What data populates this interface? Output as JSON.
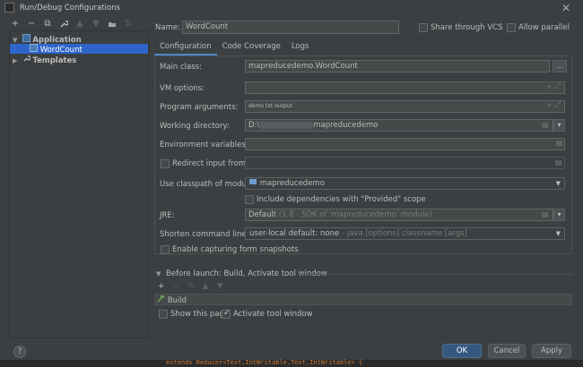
{
  "window": {
    "title": "Run/Debug Configurations",
    "close_glyph": "✕"
  },
  "toolbar": {
    "icons": [
      "add-icon",
      "remove-icon",
      "copy-icon",
      "wrench-icon",
      "move-up-icon",
      "move-down-icon",
      "folder-icon",
      "sort-icon"
    ],
    "glyphs": [
      "+",
      "−",
      "⧉",
      "🔧",
      "▲",
      "▼",
      "▤",
      "⇅"
    ]
  },
  "tree": {
    "application_label": "Application",
    "wordcount_label": "WordCount",
    "templates_label": "Templates"
  },
  "header": {
    "name_label": "Name:",
    "name_value": "WordCount",
    "share_label": "Share through VCS",
    "parallel_label": "Allow parallel run"
  },
  "tabs": [
    "Configuration",
    "Code Coverage",
    "Logs"
  ],
  "form": {
    "main_class_label": "Main class:",
    "main_class_value": "mapreducedemo.WordCount",
    "vm_options_label": "VM options:",
    "program_args_label": "Program arguments:",
    "program_args_value": "demo txt output",
    "working_dir_label": "Working directory:",
    "working_dir_prefix": "D:\\",
    "working_dir_suffix": "mapreducedemo",
    "env_vars_label": "Environment variables:",
    "redirect_label": "Redirect input from:",
    "classpath_label": "Use classpath of module:",
    "classpath_value": "mapreducedemo",
    "include_deps_label": "Include dependencies with \"Provided\" scope",
    "jre_label": "JRE:",
    "jre_value_bold": "Default",
    "jre_value_rest": "(1.8 - SDK of 'mapreducedemo' module)",
    "shorten_label": "Shorten command line:",
    "shorten_value_main": "user-local default: none",
    "shorten_value_rest": "- java [options] classname [args]",
    "capture_label": "Enable capturing form snapshots"
  },
  "before_launch": {
    "header": "Before launch: Build, Activate tool window",
    "build_item": "Build",
    "show_page_label": "Show this page",
    "activate_label": "Activate tool window"
  },
  "buttons": {
    "ok": "OK",
    "cancel": "Cancel",
    "apply": "Apply",
    "help": "?"
  },
  "editor_peek": "extends Reducer<Text,IntWritable,Text,IntWritable> {"
}
